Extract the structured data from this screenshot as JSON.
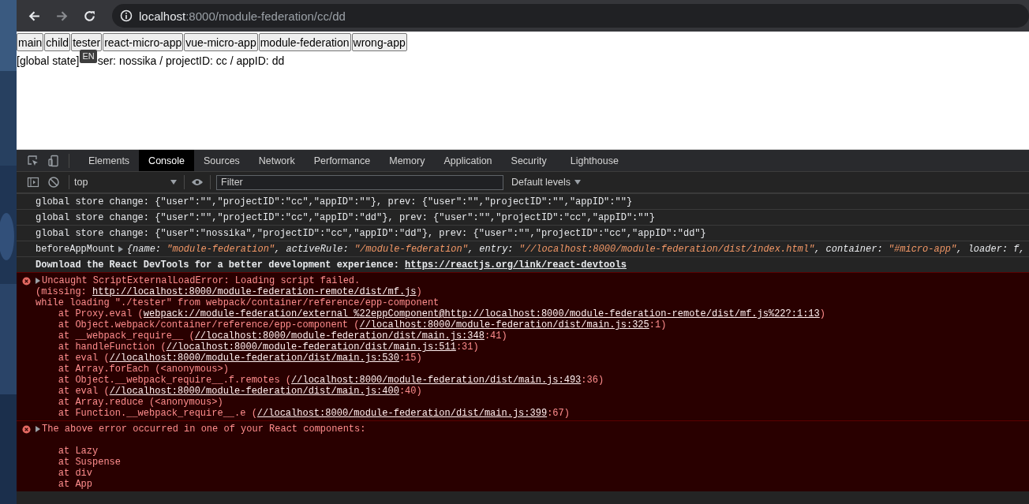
{
  "browser": {
    "address": {
      "host": "localhost",
      "path": ":8000/module-federation/cc/dd"
    }
  },
  "page": {
    "nav_buttons": [
      "main",
      "child",
      "tester",
      "react-micro-app",
      "vue-micro-app",
      "module-federation",
      "wrong-app"
    ],
    "status": {
      "label": "[global state]",
      "tooltip": "EN",
      "rest": "ser: nossika / projectID: cc / appID: dd"
    }
  },
  "devtools": {
    "tabs": [
      {
        "label": "Elements",
        "selected": false
      },
      {
        "label": "Console",
        "selected": true
      },
      {
        "label": "Sources",
        "selected": false
      },
      {
        "label": "Network",
        "selected": false
      },
      {
        "label": "Performance",
        "selected": false
      },
      {
        "label": "Memory",
        "selected": false
      },
      {
        "label": "Application",
        "selected": false
      },
      {
        "label": "Security",
        "selected": false
      },
      {
        "label": "Lighthouse",
        "selected": false
      }
    ],
    "context": "top",
    "filter": {
      "placeholder": "Filter"
    },
    "levels": "Default levels",
    "messages": [
      {
        "kind": "log",
        "lines": [
          [
            {
              "kind": "plain",
              "text": "global store change: {\"user\":\"\",\"projectID\":\"cc\",\"appID\":\"\"}, prev: {\"user\":\"\",\"projectID\":\"\",\"appID\":\"\"}"
            }
          ]
        ]
      },
      {
        "kind": "log",
        "lines": [
          [
            {
              "kind": "plain",
              "text": "global store change: {\"user\":\"\",\"projectID\":\"cc\",\"appID\":\"dd\"}, prev: {\"user\":\"\",\"projectID\":\"cc\",\"appID\":\"\"}"
            }
          ]
        ]
      },
      {
        "kind": "log",
        "lines": [
          [
            {
              "kind": "plain",
              "text": "global store change: {\"user\":\"nossika\",\"projectID\":\"cc\",\"appID\":\"dd\"}, prev: {\"user\":\"\",\"projectID\":\"cc\",\"appID\":\"dd\"}"
            }
          ]
        ]
      },
      {
        "kind": "log",
        "lines": [
          [
            {
              "kind": "plain",
              "text": "beforeAppMount"
            },
            {
              "kind": "toggle"
            },
            {
              "kind": "key",
              "text": "{name: "
            },
            {
              "kind": "string",
              "text": "\"module-federation\""
            },
            {
              "kind": "key",
              "text": ", activeRule: "
            },
            {
              "kind": "string",
              "text": "\"/module-federation\""
            },
            {
              "kind": "key",
              "text": ", entry: "
            },
            {
              "kind": "string",
              "text": "\"//localhost:8000/module-federation/dist/index.html\""
            },
            {
              "kind": "key",
              "text": ", container: "
            },
            {
              "kind": "string",
              "text": "\"#micro-app\""
            },
            {
              "kind": "key",
              "text": ", loader: f,"
            }
          ]
        ]
      },
      {
        "kind": "log",
        "lines": [
          [
            {
              "kind": "bold",
              "text": "Download the React DevTools for a better development experience: "
            },
            {
              "kind": "bold_link",
              "text": "https://reactjs.org/link/react-devtools"
            }
          ]
        ]
      },
      {
        "kind": "error",
        "lines": [
          [
            {
              "kind": "toggle"
            },
            {
              "kind": "plain",
              "text": "Uncaught ScriptExternalLoadError: Loading script failed."
            }
          ],
          [
            {
              "kind": "plain",
              "text": "(missing: "
            },
            {
              "kind": "link",
              "text": "http://localhost:8000/module-federation-remote/dist/mf.js"
            },
            {
              "kind": "plain",
              "text": ")"
            }
          ],
          [
            {
              "kind": "plain",
              "text": "while loading \"./tester\" from webpack/container/reference/epp-component"
            }
          ],
          [
            {
              "kind": "plain",
              "text": "    at Proxy.eval ("
            },
            {
              "kind": "link",
              "text": "webpack://module-federation/external %22eppComponent@http://localhost:8000/module-federation-remote/dist/mf.js%22?:1:13"
            },
            {
              "kind": "plain",
              "text": ")"
            }
          ],
          [
            {
              "kind": "plain",
              "text": "    at Object.webpack/container/reference/epp-component ("
            },
            {
              "kind": "link",
              "text": "//localhost:8000/module-federation/dist/main.js:325"
            },
            {
              "kind": "plain",
              "text": ":1)"
            }
          ],
          [
            {
              "kind": "plain",
              "text": "    at __webpack_require__ ("
            },
            {
              "kind": "link",
              "text": "//localhost:8000/module-federation/dist/main.js:348"
            },
            {
              "kind": "plain",
              "text": ":41)"
            }
          ],
          [
            {
              "kind": "plain",
              "text": "    at handleFunction ("
            },
            {
              "kind": "link",
              "text": "//localhost:8000/module-federation/dist/main.js:511"
            },
            {
              "kind": "plain",
              "text": ":31)"
            }
          ],
          [
            {
              "kind": "plain",
              "text": "    at eval ("
            },
            {
              "kind": "link",
              "text": "//localhost:8000/module-federation/dist/main.js:530"
            },
            {
              "kind": "plain",
              "text": ":15)"
            }
          ],
          [
            {
              "kind": "plain",
              "text": "    at Array.forEach (<anonymous>)"
            }
          ],
          [
            {
              "kind": "plain",
              "text": "    at Object.__webpack_require__.f.remotes ("
            },
            {
              "kind": "link",
              "text": "//localhost:8000/module-federation/dist/main.js:493"
            },
            {
              "kind": "plain",
              "text": ":36)"
            }
          ],
          [
            {
              "kind": "plain",
              "text": "    at eval ("
            },
            {
              "kind": "link",
              "text": "//localhost:8000/module-federation/dist/main.js:400"
            },
            {
              "kind": "plain",
              "text": ":40)"
            }
          ],
          [
            {
              "kind": "plain",
              "text": "    at Array.reduce (<anonymous>)"
            }
          ],
          [
            {
              "kind": "plain",
              "text": "    at Function.__webpack_require__.e ("
            },
            {
              "kind": "link",
              "text": "//localhost:8000/module-federation/dist/main.js:399"
            },
            {
              "kind": "plain",
              "text": ":67)"
            }
          ]
        ]
      },
      {
        "kind": "error",
        "lines": [
          [
            {
              "kind": "toggle"
            },
            {
              "kind": "plain",
              "text": "The above error occurred in one of your React components:"
            }
          ],
          [
            {
              "kind": "blank"
            }
          ],
          [
            {
              "kind": "plain",
              "text": "    at Lazy"
            }
          ],
          [
            {
              "kind": "plain",
              "text": "    at Suspense"
            }
          ],
          [
            {
              "kind": "plain",
              "text": "    at div"
            }
          ],
          [
            {
              "kind": "plain",
              "text": "    at App"
            }
          ]
        ]
      }
    ]
  }
}
